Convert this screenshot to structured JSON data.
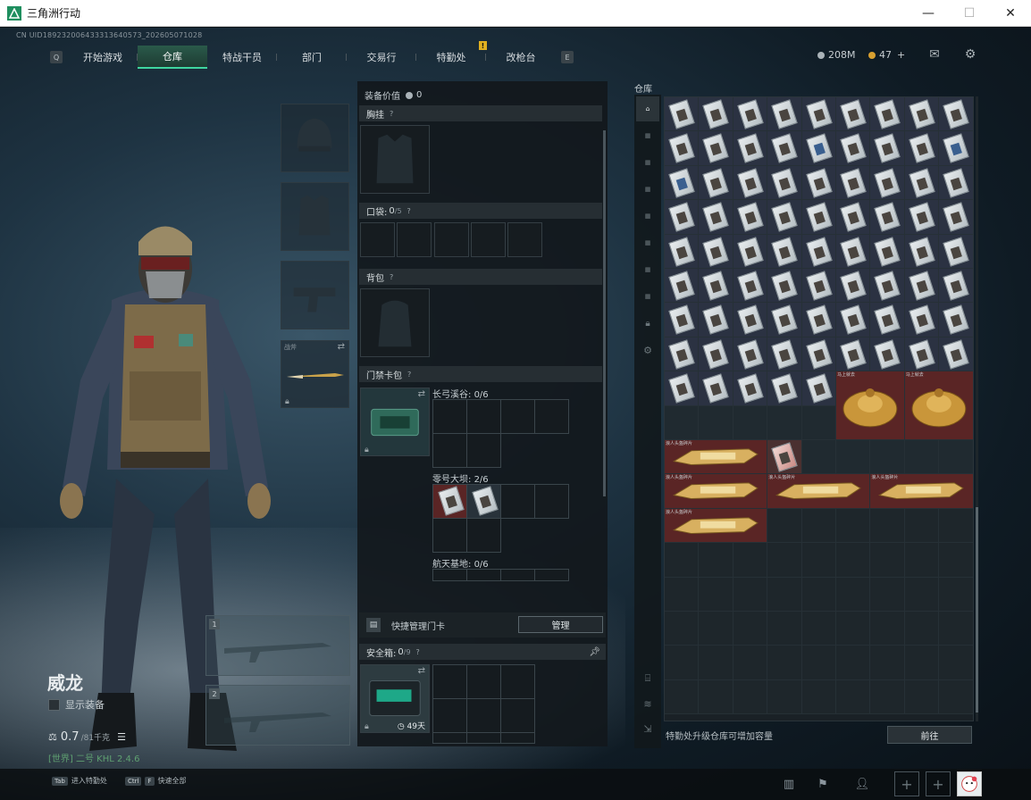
{
  "window": {
    "title": "三角洲行动",
    "minimize": "—",
    "maximize": "☐",
    "close": "✕"
  },
  "uid": "CN UID1892320064333136405​73_202605071028",
  "nav": {
    "key_left": "Q",
    "key_right": "E",
    "tabs": [
      "开始游戏",
      "仓库",
      "特战干员",
      "部门",
      "交易行",
      "特勤处",
      "改枪台"
    ],
    "active": "仓库",
    "badge": "!"
  },
  "currency": {
    "silver": "208M",
    "gold": "47",
    "plus": "+"
  },
  "character": {
    "name": "威龙",
    "show_equipment": "显示装备",
    "weight_current": "0.7",
    "weight_max": "/81千克",
    "world_tag": "[世界] 二号 KHL 2.4.6"
  },
  "equipment": {
    "melee_label": "战斧",
    "weapon1": "1",
    "weapon2": "2"
  },
  "middle": {
    "value_label": "装备价值",
    "value": "0",
    "vest": "胸挂",
    "pocket": "口袋:",
    "pocket_count": "0",
    "pocket_max": "/5",
    "backpack": "背包",
    "keycard": "门禁卡包",
    "key_groups": [
      {
        "name": "长弓溪谷:",
        "count": "0/6"
      },
      {
        "name": "零号大坝:",
        "count": "2/6"
      },
      {
        "name": "航天基地:",
        "count": "0/6"
      }
    ],
    "quick_manage": "快捷管理门卡",
    "manage": "管理",
    "safebox": "安全箱:",
    "safebox_count": "0",
    "safebox_max": "/9",
    "safebox_time": "49天",
    "help": "?"
  },
  "warehouse": {
    "title": "仓库",
    "footer_text": "特勤处升级仓库可增加容量",
    "goto": "前往",
    "tag_a": "马上就去",
    "tag_b": "马上就去",
    "tag_gold": "浪人头盔碎片"
  },
  "bottom": {
    "hint1_key": "Tab",
    "hint1": "进入特勤处",
    "hint2_key": "Ctrl",
    "hint2_key2": "F",
    "hint2": "快速全部"
  },
  "colors": {
    "accent": "#3fd6a0",
    "red_item": "#5a2525",
    "gold": "#d9a030"
  }
}
